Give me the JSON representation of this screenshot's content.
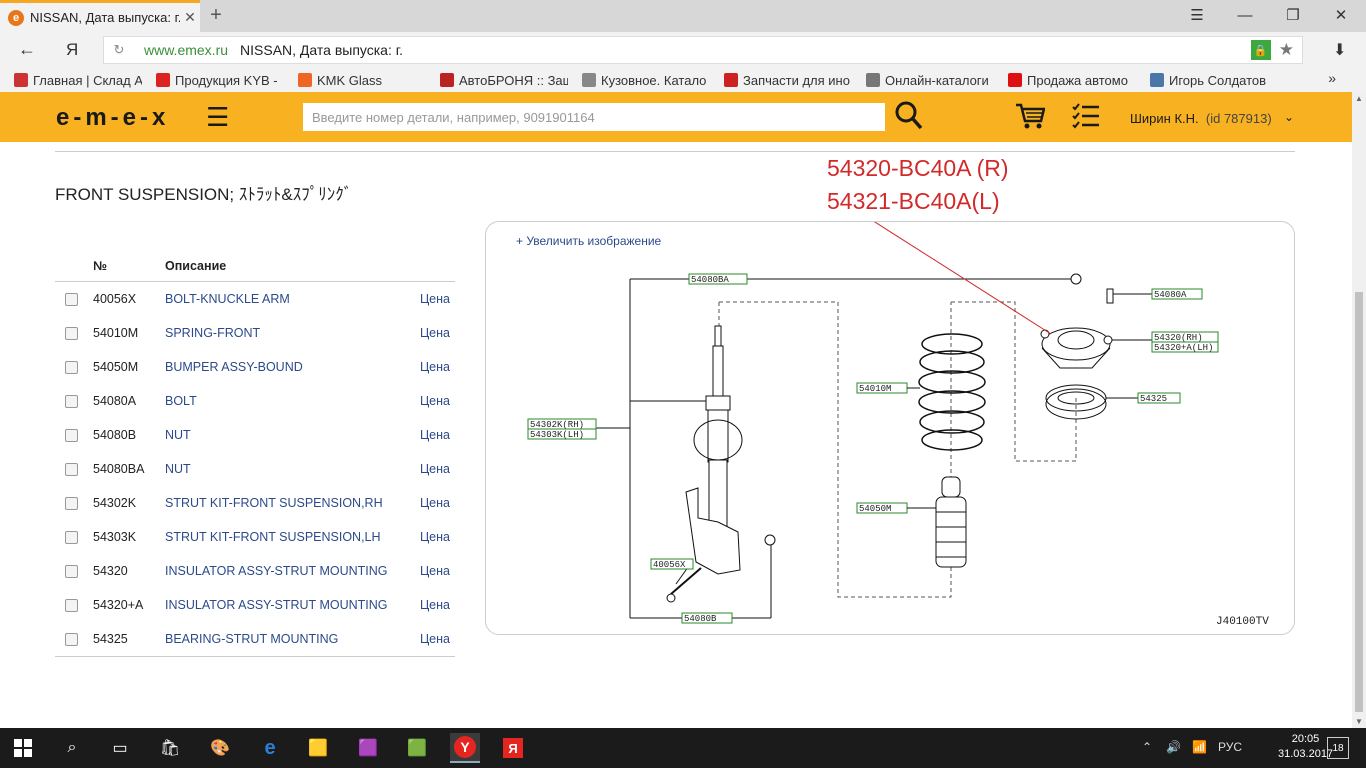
{
  "browser": {
    "tab_title": "NISSAN, Дата выпуска: г.",
    "tab_favicon": "e",
    "new_tab": "+",
    "minimize": "—",
    "restore": "❐",
    "close": "✕",
    "menu": "☰",
    "back": "←",
    "yandex": "Я",
    "reload": "↻",
    "url_domain": "www.emex.ru",
    "url_title": "NISSAN, Дата выпуска: г.",
    "download": "⬇"
  },
  "bookmarks": [
    {
      "label": "Главная | Склад А",
      "color": "#c33"
    },
    {
      "label": "Продукция KYB -",
      "color": "#d22"
    },
    {
      "label": "KMK Glass",
      "color": "#e62"
    },
    {
      "label": "АвтоБРОНЯ :: Защ",
      "color": "#b22"
    },
    {
      "label": "Кузовное. Катало",
      "color": "#888"
    },
    {
      "label": "Запчасти для ино",
      "color": "#c22"
    },
    {
      "label": "Онлайн-каталоги",
      "color": "#777"
    },
    {
      "label": "Продажа автомо",
      "color": "#d11"
    },
    {
      "label": "Игорь Солдатов",
      "color": "#4a76a8"
    }
  ],
  "bookmarks_more": "»",
  "site": {
    "logo": "e-m-e-x",
    "search_placeholder": "Введите номер детали, например, 9091901164",
    "user_name": "Ширин К.Н.",
    "user_id": "(id 787913)",
    "accent_color": "#f8b120"
  },
  "content": {
    "heading": "FRONT SUSPENSION; ｽﾄﾗｯﾄ&ｽﾌﾟﾘﾝｸﾞ",
    "col_num": "№",
    "col_desc": "Описание",
    "rows": [
      {
        "num": "40056X",
        "desc": "BOLT-KNUCKLE ARM",
        "price": "Цена"
      },
      {
        "num": "54010M",
        "desc": "SPRING-FRONT",
        "price": "Цена"
      },
      {
        "num": "54050M",
        "desc": "BUMPER ASSY-BOUND",
        "price": "Цена"
      },
      {
        "num": "54080A",
        "desc": "BOLT",
        "price": "Цена"
      },
      {
        "num": "54080B",
        "desc": "NUT",
        "price": "Цена"
      },
      {
        "num": "54080BA",
        "desc": "NUT",
        "price": "Цена"
      },
      {
        "num": "54302K",
        "desc": "STRUT KIT-FRONT SUSPENSION,RH",
        "price": "Цена"
      },
      {
        "num": "54303K",
        "desc": "STRUT KIT-FRONT SUSPENSION,LH",
        "price": "Цена"
      },
      {
        "num": "54320",
        "desc": "INSULATOR ASSY-STRUT MOUNTING",
        "price": "Цена"
      },
      {
        "num": "54320+A",
        "desc": "INSULATOR ASSY-STRUT MOUNTING",
        "price": "Цена"
      },
      {
        "num": "54325",
        "desc": "BEARING-STRUT MOUNTING",
        "price": "Цена"
      }
    ],
    "zoom_link": "+ Увеличить изображение",
    "annotation_1": "54320-BC40A (R)",
    "annotation_2": "54321-BC40A(L)",
    "diagram": {
      "code": "J40100TV",
      "labels": {
        "l54080BA": "54080BA",
        "l54080A": "54080A",
        "l54320rh": "54320(RH)",
        "l54320lh": "54320+A(LH)",
        "l54325": "54325",
        "l54010M": "54010M",
        "l54302K": "54302K(RH)",
        "l54303K": "54303K(LH)",
        "l54050M": "54050M",
        "l40056X": "40056X",
        "l54080B": "54080B"
      }
    }
  },
  "taskbar": {
    "lang": "РУС",
    "time": "20:05",
    "date": "31.03.2017",
    "notifications": "18"
  }
}
